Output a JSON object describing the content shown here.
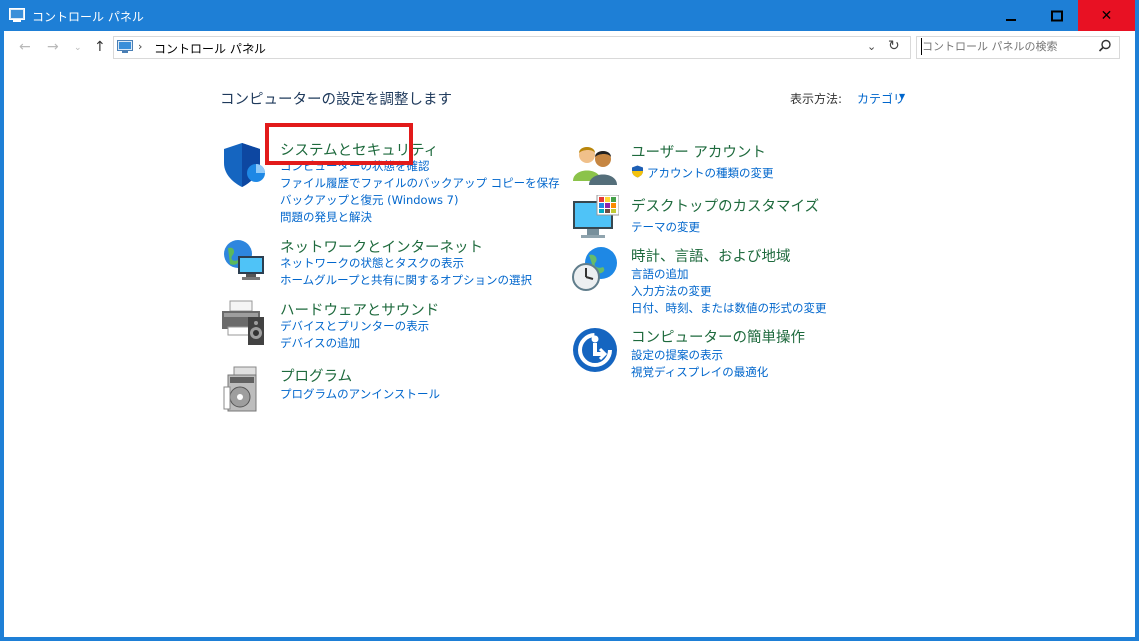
{
  "window": {
    "title": "コントロール パネル",
    "close_glyph": "✕"
  },
  "nav": {
    "back_glyph": "←",
    "forward_glyph": "→",
    "recent_glyph": "⌄",
    "up_glyph": "↑",
    "crumb_sep": "›",
    "breadcrumb": "コントロール パネル",
    "dropdown_glyph": "⌄",
    "refresh_glyph": "↻",
    "search_placeholder": "コントロール パネルの検索"
  },
  "main": {
    "heading": "コンピューターの設定を調整します",
    "view_by_label": "表示方法:",
    "view_by_value": "カテゴリ",
    "view_by_arrow": "▼"
  },
  "left_categories": [
    {
      "title": "システムとセキュリティ",
      "icon": "shield-icon",
      "links": [
        "コンピューターの状態を確認",
        "ファイル履歴でファイルのバックアップ コピーを保存",
        "バックアップと復元 (Windows 7)",
        "問題の発見と解決"
      ]
    },
    {
      "title": "ネットワークとインターネット",
      "icon": "network-globe-icon",
      "links": [
        "ネットワークの状態とタスクの表示",
        "ホームグループと共有に関するオプションの選択"
      ]
    },
    {
      "title": "ハードウェアとサウンド",
      "icon": "printer-speaker-icon",
      "links": [
        "デバイスとプリンターの表示",
        "デバイスの追加"
      ]
    },
    {
      "title": "プログラム",
      "icon": "programs-disc-icon",
      "links": [
        "プログラムのアンインストール"
      ]
    }
  ],
  "right_categories": [
    {
      "title": "ユーザー アカウント",
      "icon": "users-icon",
      "links": [
        "アカウントの種類の変更"
      ]
    },
    {
      "title": "デスクトップのカスタマイズ",
      "icon": "monitor-palette-icon",
      "links": [
        "テーマの変更"
      ]
    },
    {
      "title": "時計、言語、および地域",
      "icon": "clock-globe-icon",
      "links": [
        "言語の追加",
        "入力方法の変更",
        "日付、時刻、または数値の形式の変更"
      ]
    },
    {
      "title": "コンピューターの簡単操作",
      "icon": "ease-of-access-icon",
      "links": [
        "設定の提案の表示",
        "視覚ディスプレイの最適化"
      ]
    }
  ],
  "colors": {
    "title_bar": "#1e7fd6",
    "close_button": "#e81123",
    "link": "#0066cc",
    "category_title": "#1e6a3d",
    "highlight_box": "#e21a1a"
  }
}
